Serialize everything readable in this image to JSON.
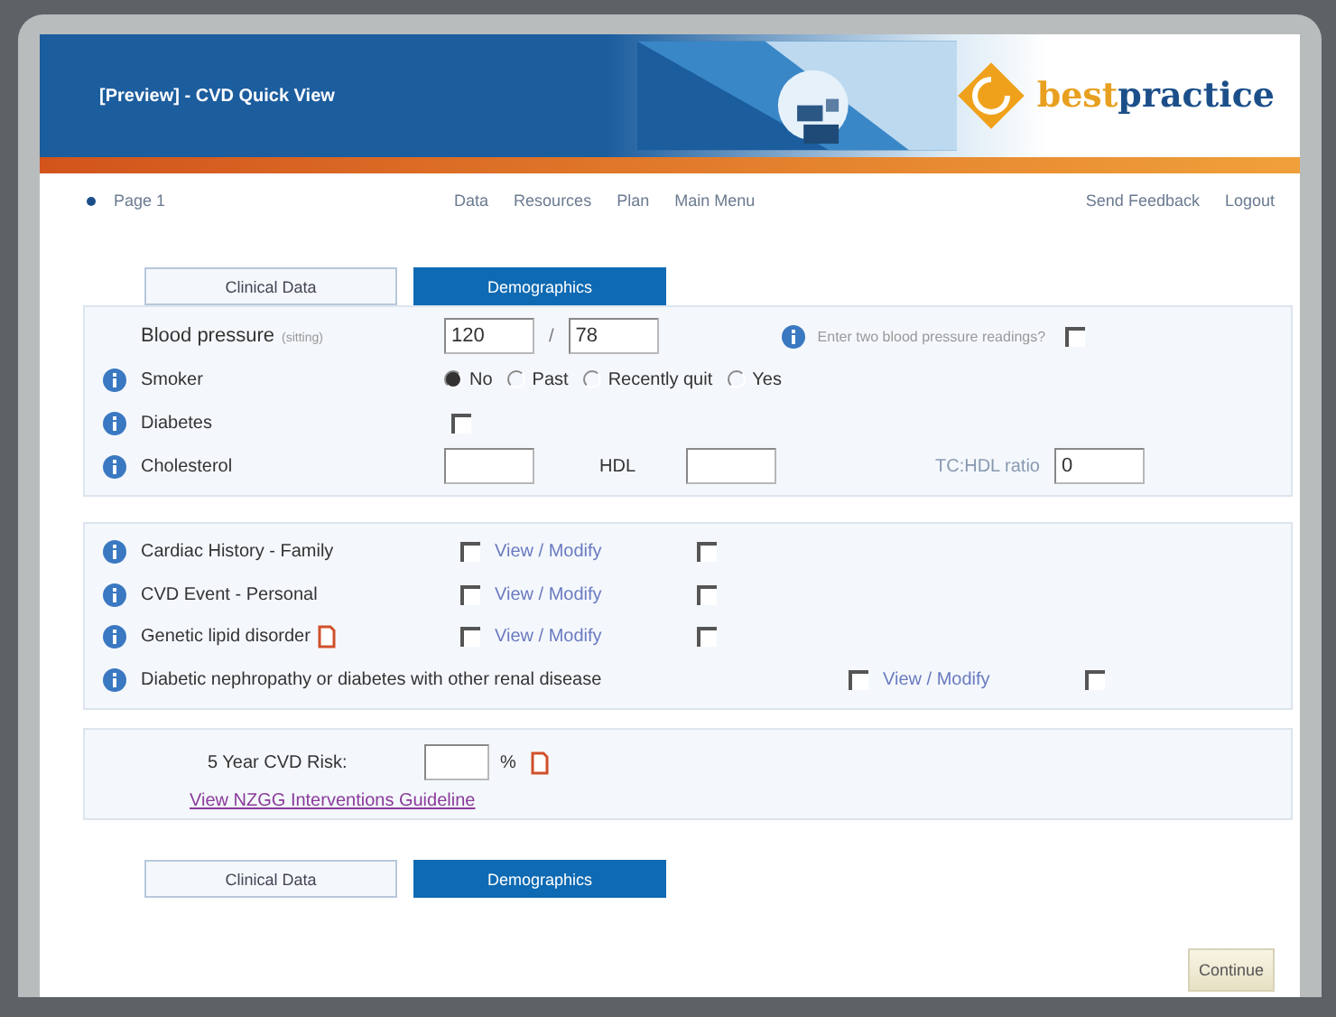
{
  "window": {
    "title": "[Preview] - CVD Quick View"
  },
  "logo": {
    "text_a": "best",
    "text_b": "practice"
  },
  "nav": {
    "page": "Page 1",
    "links": [
      "Data",
      "Resources",
      "Plan",
      "Main Menu"
    ],
    "right_links": [
      "Send Feedback",
      "Logout"
    ]
  },
  "tabs": [
    {
      "label": "Clinical Data",
      "selected": true
    },
    {
      "label": "Demographics",
      "selected": false
    }
  ],
  "clinical": {
    "blood_pressure": {
      "label": "Blood pressure",
      "note": "(sitting)",
      "systolic": "120",
      "separator": "/",
      "diastolic": "78",
      "question": "Enter two blood pressure readings?",
      "checked": false
    },
    "smoker": {
      "label": "Smoker",
      "options": [
        {
          "label": "No",
          "selected": true
        },
        {
          "label": "Past",
          "selected": false
        },
        {
          "label": "Recently quit",
          "selected": false
        },
        {
          "label": "Yes",
          "selected": false
        }
      ]
    },
    "diabetes": {
      "label": "Diabetes",
      "checked": false
    },
    "cholesterol": {
      "label": "Cholesterol",
      "hdl_label": "HDL",
      "ratio_label": "TC:HDL ratio",
      "ratio": "0"
    }
  },
  "history": [
    {
      "label": "Cardiac History - Family",
      "note_icon": false,
      "checked": false,
      "link": "View / Modify",
      "checked_2": false
    },
    {
      "label": "CVD Event - Personal",
      "note_icon": false,
      "checked": false,
      "link": "View / Modify",
      "checked_2": false
    },
    {
      "label": "Genetic lipid disorder",
      "note_icon": true,
      "checked": false,
      "link": "View / Modify",
      "checked_2": false
    },
    {
      "label": "Diabetic nephropathy or diabetes with other renal disease",
      "note_icon": false,
      "checked": false,
      "link": "View / Modify",
      "checked_2": false
    }
  ],
  "risk": {
    "label": "5 Year CVD Risk:",
    "unit": "%",
    "link": "View NZGG Interventions Guideline"
  },
  "bottom_tabs": [
    {
      "label": "Clinical Data",
      "selected": true
    },
    {
      "label": "Demographics",
      "selected": false
    }
  ],
  "continue_button": "Continue"
}
